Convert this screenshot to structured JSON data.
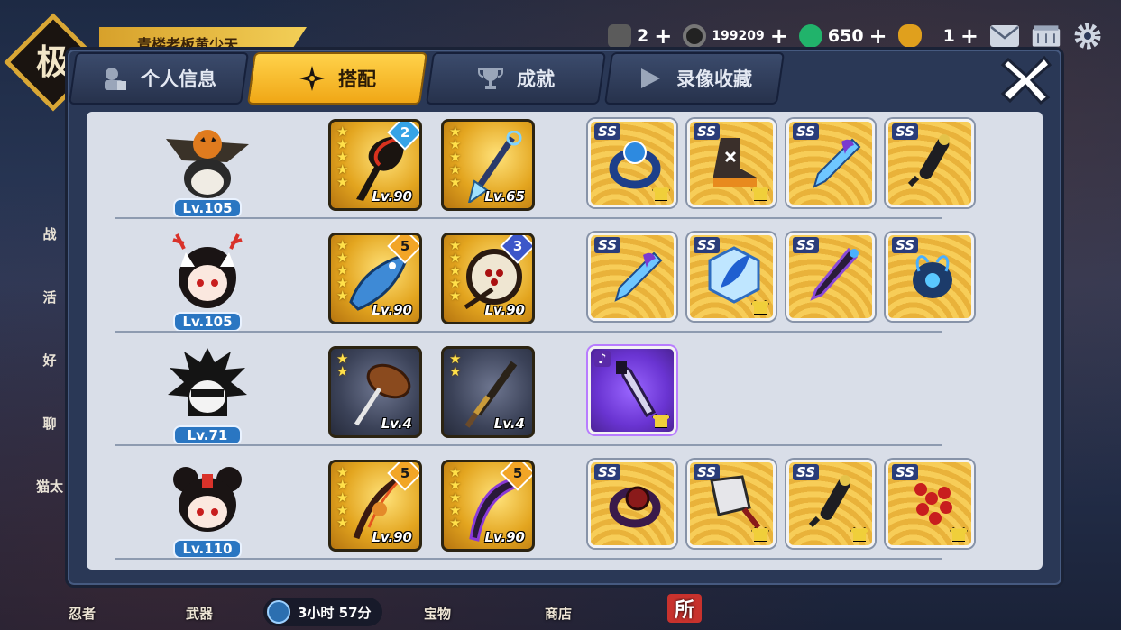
{
  "player": {
    "name": "青楼老板黄少天",
    "emblem_char": "极"
  },
  "resources": [
    {
      "icon": "scroll-icon",
      "value": "2",
      "plus": "+"
    },
    {
      "icon": "coin-icon",
      "value": "199209",
      "plus": "+"
    },
    {
      "icon": "jade-icon",
      "value": "650",
      "plus": "+"
    },
    {
      "icon": "gourd-icon",
      "value": "1",
      "plus": "+"
    }
  ],
  "top_icons": [
    "mail-icon",
    "ticket-icon",
    "gear-icon"
  ],
  "tabs": [
    {
      "label": "个人信息",
      "icon": "profile-icon",
      "active": false
    },
    {
      "label": "搭配",
      "icon": "shuriken-icon",
      "active": true
    },
    {
      "label": "成就",
      "icon": "trophy-icon",
      "active": false
    },
    {
      "label": "录像收藏",
      "icon": "play-icon",
      "active": false
    }
  ],
  "close_icon": "close-icon",
  "side_menu": [
    "战",
    "活",
    "好",
    "聊",
    "猫太"
  ],
  "bottom_nav": [
    "忍者",
    "武器",
    "宝物",
    "商店",
    "所"
  ],
  "timer": "3小时 57分",
  "loadouts": [
    {
      "hero": {
        "name": "pumpkin-hat-ninja",
        "level": "Lv.105"
      },
      "weapons": [
        {
          "type": "gold",
          "stars": 5,
          "level": "Lv.90",
          "rank": "2",
          "rank_color": "blue",
          "icon": "dark-scythe-icon"
        },
        {
          "type": "gold",
          "stars": 5,
          "level": "Lv.65",
          "rank": "",
          "rank_color": "",
          "icon": "ice-spear-icon"
        }
      ],
      "accessories": [
        {
          "grade": "SS",
          "icon": "blue-ring-icon"
        },
        {
          "grade": "SS",
          "icon": "boot-icon"
        },
        {
          "grade": "SS",
          "icon": "crystal-dart-icon"
        },
        {
          "grade": "SS",
          "icon": "black-scroll-icon"
        }
      ]
    },
    {
      "hero": {
        "name": "antler-girl-ninja",
        "level": "Lv.105"
      },
      "weapons": [
        {
          "type": "gold",
          "stars": 5,
          "level": "Lv.90",
          "rank": "5",
          "rank_color": "orange",
          "icon": "shark-blade-icon"
        },
        {
          "type": "gold",
          "stars": 5,
          "level": "Lv.90",
          "rank": "3",
          "rank_color": "purple",
          "icon": "war-drum-icon"
        }
      ],
      "accessories": [
        {
          "grade": "SS",
          "icon": "crystal-dart-icon"
        },
        {
          "grade": "SS",
          "icon": "ice-feather-icon"
        },
        {
          "grade": "SS",
          "icon": "purple-kunai-icon"
        },
        {
          "grade": "SS",
          "icon": "blue-beetle-icon"
        }
      ]
    },
    {
      "hero": {
        "name": "spiky-hair-ninja",
        "level": "Lv.71"
      },
      "weapons": [
        {
          "type": "dark",
          "stars": 2,
          "level": "Lv.4",
          "rank": "",
          "rank_color": "",
          "icon": "wooden-axe-icon"
        },
        {
          "type": "dark",
          "stars": 2,
          "level": "Lv.4",
          "rank": "",
          "rank_color": "",
          "icon": "short-sword-icon"
        }
      ],
      "accessories": [
        {
          "grade": "♪",
          "icon": "purple-dagger-icon",
          "purple": true
        }
      ]
    },
    {
      "hero": {
        "name": "bun-hair-ninja",
        "level": "Lv.110"
      },
      "weapons": [
        {
          "type": "gold",
          "stars": 5,
          "level": "Lv.90",
          "rank": "5",
          "rank_color": "orange",
          "icon": "fire-bow-icon"
        },
        {
          "type": "gold",
          "stars": 5,
          "level": "Lv.90",
          "rank": "5",
          "rank_color": "orange",
          "icon": "purple-scythe-icon"
        }
      ],
      "accessories": [
        {
          "grade": "SS",
          "icon": "dark-ring-icon"
        },
        {
          "grade": "SS",
          "icon": "cleaver-icon"
        },
        {
          "grade": "SS",
          "icon": "black-scroll-icon"
        },
        {
          "grade": "SS",
          "icon": "red-beads-icon"
        }
      ]
    }
  ]
}
